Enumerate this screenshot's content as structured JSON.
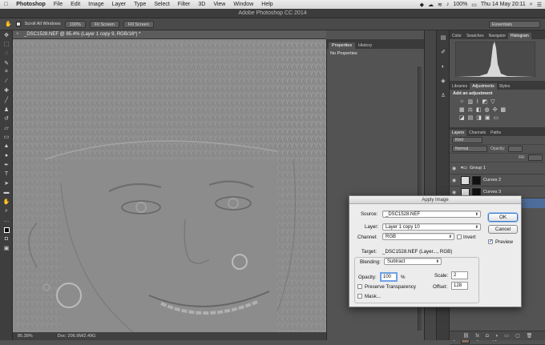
{
  "menubar": {
    "app_name": "Photoshop",
    "items": [
      "File",
      "Edit",
      "Image",
      "Layer",
      "Type",
      "Select",
      "Filter",
      "3D",
      "View",
      "Window",
      "Help"
    ],
    "battery": "100%",
    "clock": "Thu 14 May  20:11"
  },
  "window_title": "Adobe Photoshop CC 2014",
  "options_bar": {
    "scroll_all_windows": "Scroll All Windows",
    "btn_100": "100%",
    "btn_fit_screen": "Fit Screen",
    "btn_fill_screen": "Fill Screen",
    "workspace": "Essentials"
  },
  "document": {
    "tab_title": "_DSC1528.NEF @ 85.4% (Layer 1 copy 9, RGB/16*) *",
    "zoom": "85.38%",
    "doc_size": "Doc: 206.9M/2.49G"
  },
  "properties_panel": {
    "tabs": [
      "Properties",
      "History"
    ],
    "message": "No Properties"
  },
  "right_panel": {
    "top_tabs": [
      "Color",
      "Swatches",
      "Navigator",
      "Histogram"
    ],
    "adj_tabs": [
      "Libraries",
      "Adjustments",
      "Styles"
    ],
    "add_adjustment": "Add an adjustment",
    "layer_tabs": [
      "Layers",
      "Channels",
      "Paths"
    ],
    "kind": "Kind",
    "blend": "Normal",
    "opacity_label": "Opacity:",
    "fill_label": "Fill:",
    "layers": [
      {
        "name": "Group 1"
      },
      {
        "name": "Curves 2"
      },
      {
        "name": "Curves 3"
      },
      {
        "name": "Layer 1 copy 4"
      }
    ]
  },
  "dialog": {
    "title": "Apply Image",
    "source_label": "Source:",
    "source_value": "_DSC1528.NEF",
    "layer_label": "Layer:",
    "layer_value": "Layer 1 copy 10",
    "channel_label": "Channel:",
    "channel_value": "RGB",
    "invert_label": "Invert",
    "target_label": "Target:",
    "target_value": "_DSC1528.NEF (Layer..., RGB)",
    "blending_label": "Blending:",
    "blending_value": "Subtract",
    "opacity_label": "Opacity:",
    "opacity_value": "100",
    "opacity_unit": "%",
    "scale_label": "Scale:",
    "scale_value": "2",
    "offset_label": "Offset:",
    "offset_value": "128",
    "preserve_label": "Preserve Transparency",
    "mask_label": "Mask...",
    "ok": "OK",
    "cancel": "Cancel",
    "preview_label": "Preview"
  }
}
